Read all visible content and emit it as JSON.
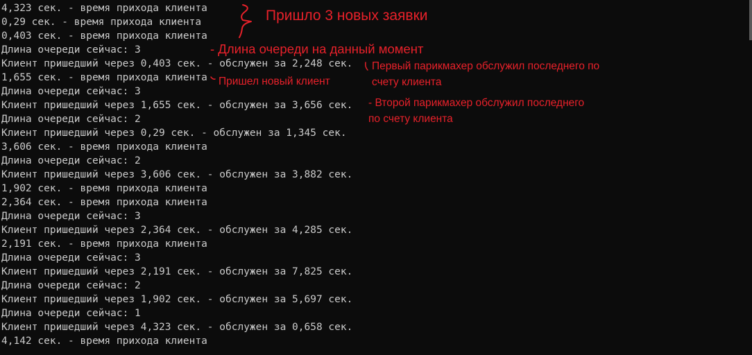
{
  "console": {
    "lines": [
      "4,323 сек. - время прихода клиента",
      "0,29 сек. - время прихода клиента",
      "0,403 сек. - время прихода клиента",
      "Длина очереди сейчас: 3",
      "Клиент пришедший через 0,403 сек. - обслужен за 2,248 сек.",
      "1,655 сек. - время прихода клиента",
      "Длина очереди сейчас: 3",
      "Клиент пришедший через 1,655 сек. - обслужен за 3,656 сек.",
      "Длина очереди сейчас: 2",
      "Клиент пришедший через 0,29 сек. - обслужен за 1,345 сек.",
      "3,606 сек. - время прихода клиента",
      "Длина очереди сейчас: 2",
      "Клиент пришедший через 3,606 сек. - обслужен за 3,882 сек.",
      "1,902 сек. - время прихода клиента",
      "2,364 сек. - время прихода клиента",
      "Длина очереди сейчас: 3",
      "Клиент пришедший через 2,364 сек. - обслужен за 4,285 сек.",
      "2,191 сек. - время прихода клиента",
      "Длина очереди сейчас: 3",
      "Клиент пришедший через 2,191 сек. - обслужен за 7,825 сек.",
      "Длина очереди сейчас: 2",
      "Клиент пришедший через 1,902 сек. - обслужен за 5,697 сек.",
      "Длина очереди сейчас: 1",
      "Клиент пришедший через 4,323 сек. - обслужен за 0,658 сек.",
      "4,142 сек. - время прихода клиента"
    ]
  },
  "annotations": {
    "three_new": "Пришло 3 новых заявки",
    "queue_length": "- Длина очереди на данный момент",
    "first_barber_line1": "Первый парикмахер обслужил последнего по",
    "first_barber_line2": "счету клиента",
    "new_client": "Пришел новый клиент",
    "second_barber_line1": "- Второй парикмахер обслужил последнего",
    "second_barber_line2": "по счету клиента"
  },
  "colors": {
    "background": "#0c0c0c",
    "console_text": "#cccccc",
    "annotation": "#e8212a"
  }
}
